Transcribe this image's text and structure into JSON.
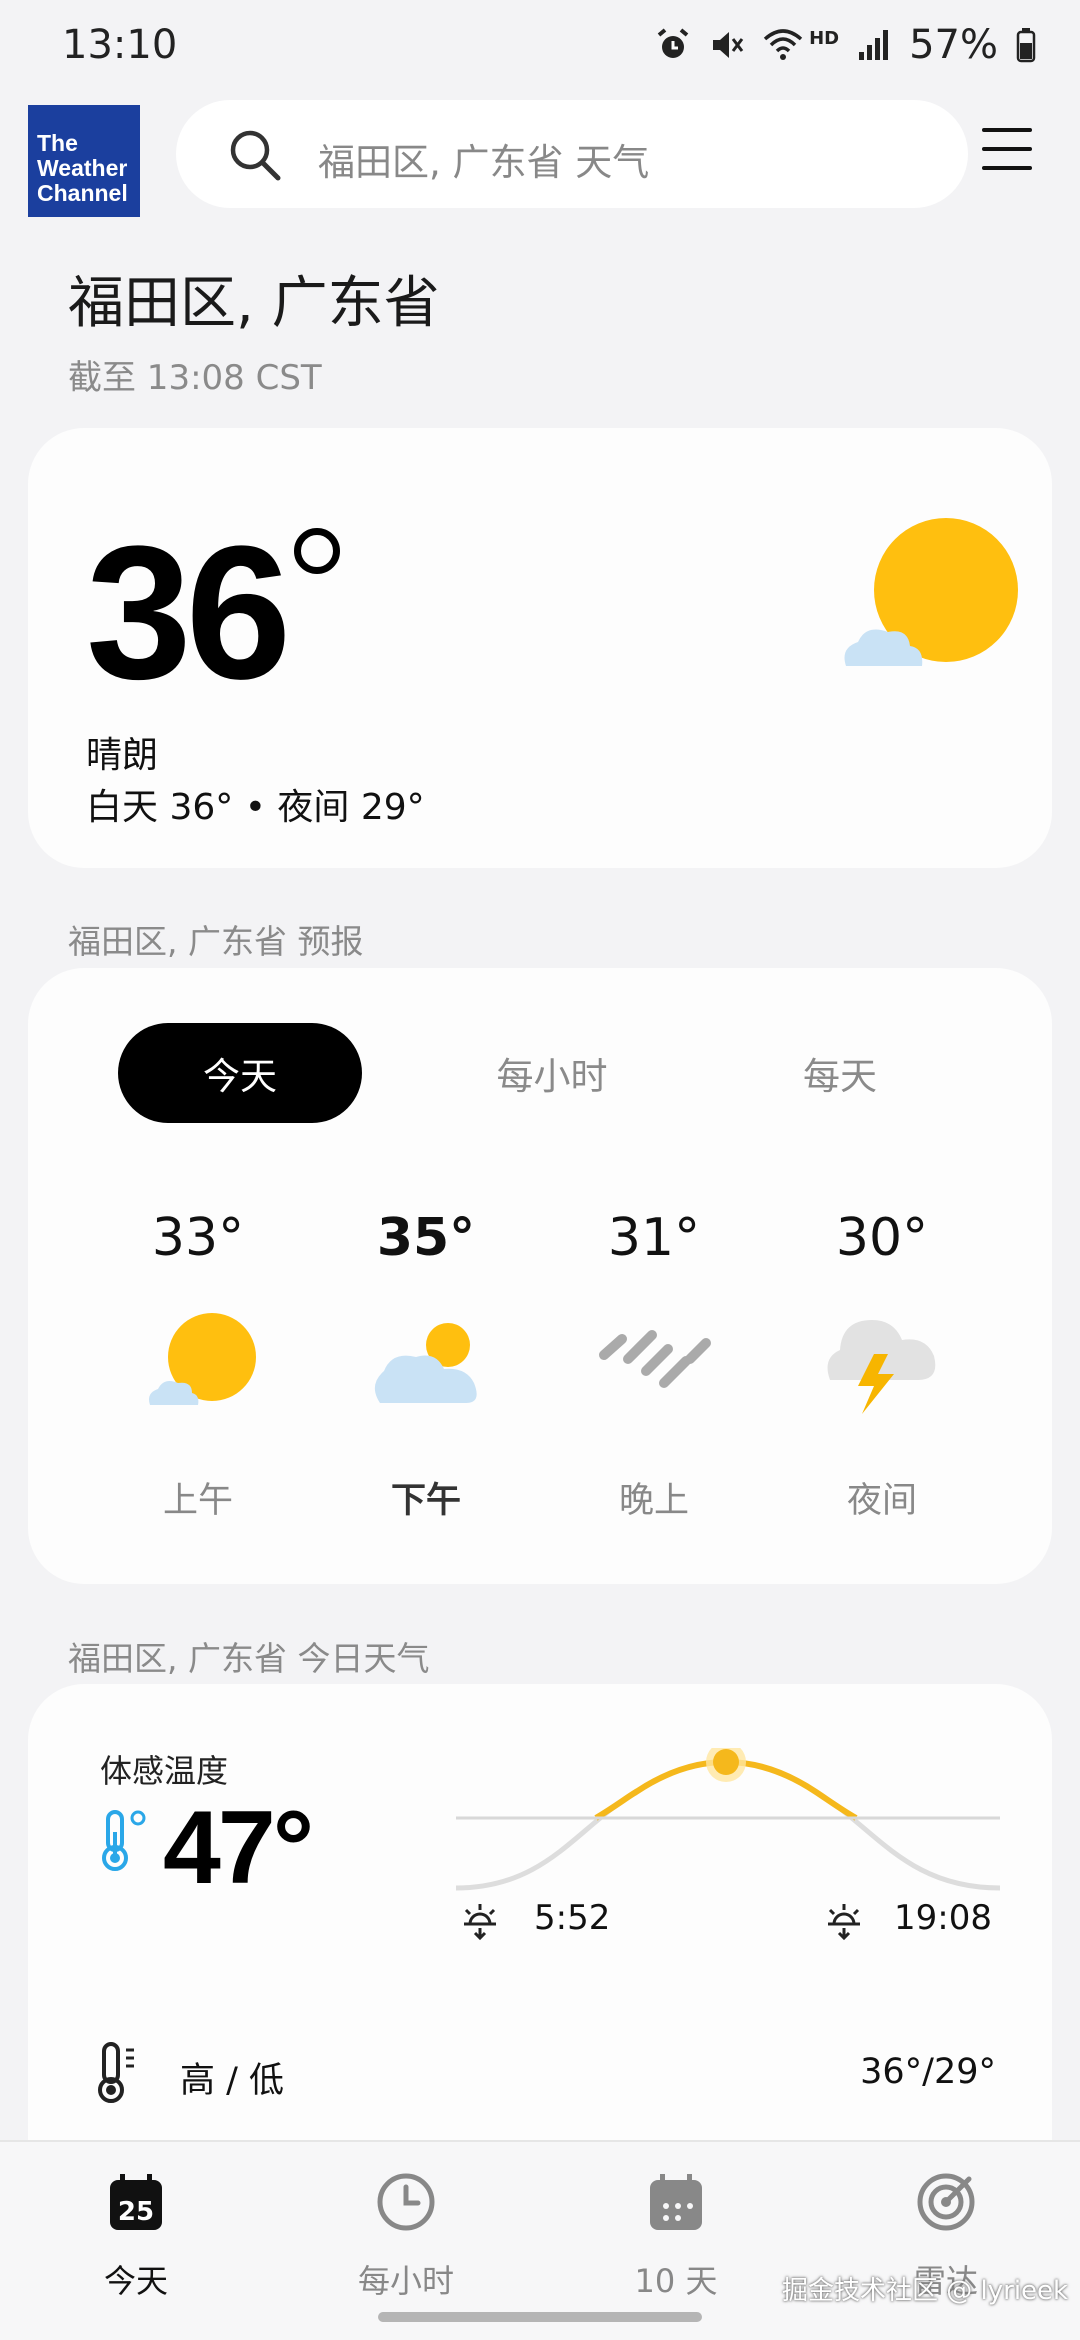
{
  "status": {
    "time": "13:10",
    "hd": "HD",
    "battery": "57%"
  },
  "header": {
    "logo_lines": [
      "The",
      "Weather",
      "Channel"
    ],
    "search_text": "福田区, 广东省 天气"
  },
  "location": {
    "title": "福田区, 广东省",
    "updated": "截至 13:08 CST"
  },
  "current": {
    "temp": "36",
    "condition": "晴朗",
    "hilo": "白天 36° • 夜间 29°",
    "icon": "sun-cloud-icon"
  },
  "forecast": {
    "section_label": "福田区, 广东省 预报",
    "tabs": [
      "今天",
      "每小时",
      "每天"
    ],
    "active_tab": 0,
    "periods": [
      {
        "temp": "33°",
        "label": "上午",
        "icon": "sun-cloud-icon"
      },
      {
        "temp": "35°",
        "label": "下午",
        "icon": "cloud-sun-icon"
      },
      {
        "temp": "31°",
        "label": "晚上",
        "icon": "rain-icon"
      },
      {
        "temp": "30°",
        "label": "夜间",
        "icon": "thunderstorm-icon"
      }
    ]
  },
  "today": {
    "section_label": "福田区, 广东省 今日天气",
    "feels_label": "体感温度",
    "feels_temp": "47°",
    "sunrise": "5:52",
    "sunset": "19:08",
    "hl_label": "高 / 低",
    "hl_value": "36°/29°"
  },
  "nav": {
    "items": [
      {
        "label": "今天",
        "icon": "calendar-today-icon",
        "badge": "25"
      },
      {
        "label": "每小时",
        "icon": "clock-icon"
      },
      {
        "label": "10 天",
        "icon": "calendar-icon"
      },
      {
        "label": "雷达",
        "icon": "radar-icon"
      }
    ],
    "active": 0
  },
  "watermark": "掘金技术社区 @ lyrieek",
  "colors": {
    "sun": "#FFBF0F",
    "cloud": "#C9E2F5",
    "thunder_cloud": "#E2E2E2",
    "bolt": "#F7B500",
    "thermo_blue": "#2AA7E8",
    "active_tab_bg": "#000000"
  }
}
